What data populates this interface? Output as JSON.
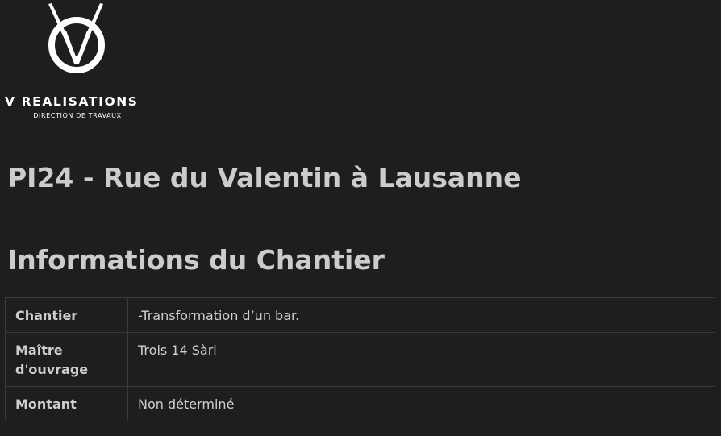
{
  "logo": {
    "name": "V REALISATIONS",
    "subtitle": "DIRECTION DE TRAVAUX"
  },
  "page_title": "PI24 - Rue du Valentin à Lausanne",
  "section_title": "Informations du Chantier",
  "info_table": {
    "rows": [
      {
        "label": "Chantier",
        "value": "-Transformation d’un bar."
      },
      {
        "label": "Maître d'ouvrage",
        "value": "Trois 14 Sàrl"
      },
      {
        "label": "Montant",
        "value": "Non déterminé"
      }
    ]
  },
  "colors": {
    "background": "#1e1e1e",
    "text": "#d4d4d4",
    "logo": "#ffffff",
    "border": "#3a3a3a"
  }
}
